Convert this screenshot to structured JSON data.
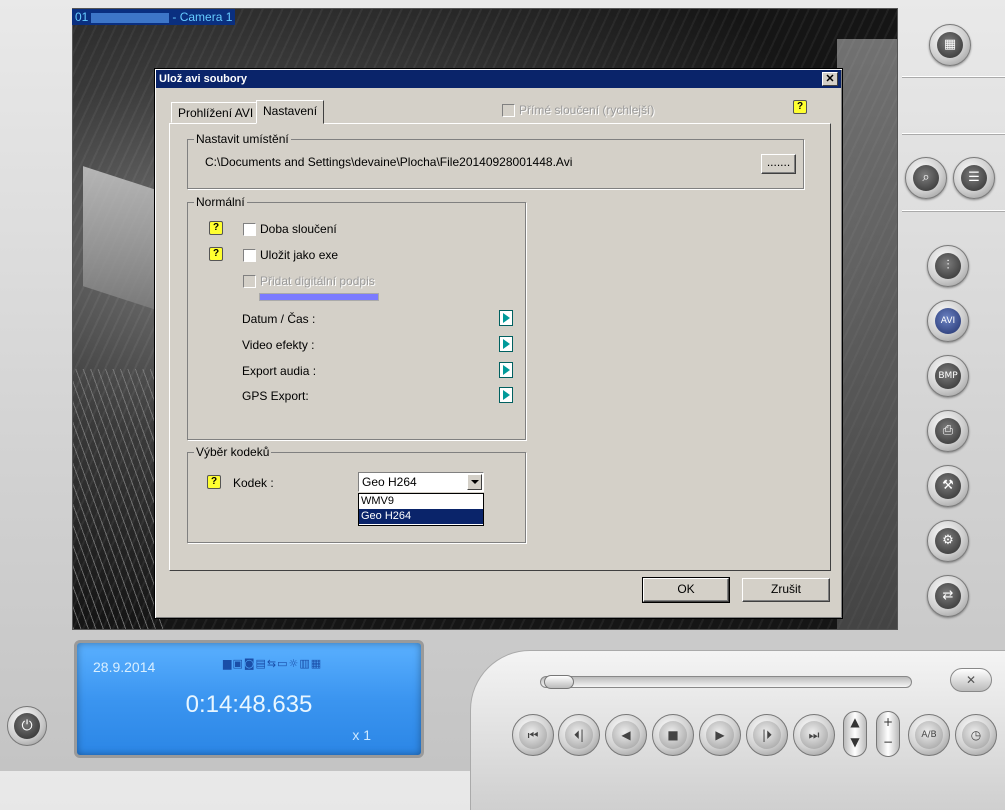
{
  "camera": {
    "number": "01",
    "name": "Camera 1"
  },
  "dialog": {
    "title": "Ulož avi soubory",
    "close_glyph": "✕",
    "tabs": [
      {
        "label": "Prohlížení AVI"
      },
      {
        "label": "Nastavení"
      }
    ],
    "direct_merge_label": "Přímé sloučení (rychlejší)",
    "help_glyph": "?",
    "location": {
      "group_label": "Nastavit umístění",
      "path": "C:\\Documents and Settings\\devaine\\Plocha\\File20140928001448.Avi",
      "browse_label": "......."
    },
    "normal": {
      "group_label": "Normální",
      "merge_time_label": "Doba sloučení",
      "save_as_exe_label": "Uložit jako exe",
      "digital_signature_label": "Přidat digitální podpis",
      "datetime_label": "Datum / Čas :",
      "video_effects_label": "Video efekty :",
      "export_audio_label": "Export audia :",
      "gps_export_label": "GPS Export:"
    },
    "codec": {
      "group_label": "Výběr kodeků",
      "label": "Kodek :",
      "selected": "Geo H264",
      "options": [
        "WMV9",
        "Geo H264"
      ]
    },
    "ok_label": "OK",
    "cancel_label": "Zrušit"
  },
  "status": {
    "date": "28.9.2014",
    "time": "0:14:48.635",
    "speed": "x 1",
    "indicators": "▆▣◙▤⇆▭☼▥▦"
  },
  "seek": {
    "position": 0.0
  },
  "icons": {
    "layout": "▦",
    "search": "⌕",
    "list": "☰",
    "adjust": "⫶",
    "save_avi": "AVI",
    "save_bmp": "BMP",
    "print": "⎙",
    "tools": "⚒",
    "settings": "⚙",
    "export": "⇄",
    "power": "⏻",
    "first": "⏮",
    "prev": "⏴|",
    "back": "◀",
    "stop": "■",
    "play": "▶",
    "next": "|⏵",
    "last": "⏭",
    "up": "▲",
    "down": "▼",
    "plus": "+",
    "minus": "−",
    "ab": "A/B",
    "clock": "◷",
    "x": "✕"
  }
}
